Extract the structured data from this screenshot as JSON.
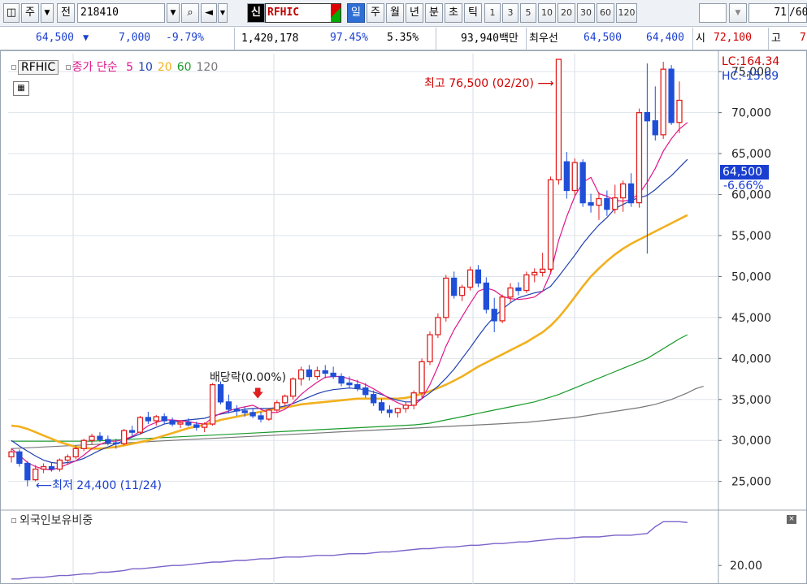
{
  "toolbar": {
    "type_label": "주",
    "prev_label": "전",
    "code": "218410",
    "new_badge": "신",
    "stock_name": "RFHIC",
    "periods": [
      "일",
      "주",
      "월",
      "년",
      "분",
      "초",
      "틱"
    ],
    "active_period": "일",
    "intervals": [
      "1",
      "3",
      "5",
      "10",
      "20",
      "30",
      "60",
      "120"
    ],
    "page": "71",
    "page_total": "/60"
  },
  "quote": {
    "price": "64,500",
    "change_arrow": "▼",
    "change": "7,000",
    "change_pct": "-9.79%",
    "volume": "1,420,178",
    "vol_ratio": "97.45%",
    "turnover": "5.35%",
    "amount": "93,940백만",
    "bid_label": "최우선",
    "ask": "64,500",
    "bid": "64,400",
    "open_label": "시",
    "open": "72,100",
    "high_label": "고",
    "high_trunc": "7"
  },
  "legend": {
    "name": "RFHIC",
    "ma_label": "종가 단순",
    "ma_periods": [
      "5",
      "10",
      "20",
      "60",
      "120"
    ],
    "ma_colors": [
      "#e0168c",
      "#1f3fb0",
      "#f2b01e",
      "#1a9a2a",
      "#777777"
    ],
    "lc": "LC:164.34",
    "hc": "HC:-15.69",
    "sub_label": "외국인보유비중"
  },
  "annotations": {
    "high": "최고 76,500 (02/20)",
    "low": "최저 24,400 (11/24)",
    "dividend": "배당락(0.00%)"
  },
  "price_box": {
    "value": "64,500",
    "pct": "-6.66%"
  },
  "colors": {
    "up": "#e0201e",
    "down": "#1f4fd8",
    "accent": "#2e6fd6"
  },
  "chart_data": {
    "type": "candlestick",
    "title": "RFHIC",
    "y_ticks": [
      25000,
      30000,
      35000,
      40000,
      45000,
      50000,
      55000,
      60000,
      65000,
      70000,
      75000
    ],
    "y_tick_labels": [
      "25,000",
      "30,000",
      "35,000",
      "40,000",
      "45,000",
      "50,000",
      "55,000",
      "60,000",
      "65,000",
      "70,000",
      "75,000"
    ],
    "ylim": [
      21500,
      77200
    ],
    "grid": true,
    "candles": [
      [
        28000,
        29000,
        27300,
        28600
      ],
      [
        28600,
        28900,
        26800,
        27200
      ],
      [
        27200,
        27500,
        24400,
        25200
      ],
      [
        25200,
        27000,
        25000,
        26500
      ],
      [
        26500,
        27200,
        26000,
        26800
      ],
      [
        26800,
        27300,
        26200,
        26500
      ],
      [
        26500,
        27800,
        26200,
        27600
      ],
      [
        27600,
        28300,
        27000,
        28000
      ],
      [
        28000,
        29300,
        27700,
        29000
      ],
      [
        29000,
        30200,
        28700,
        30000
      ],
      [
        30000,
        30800,
        29500,
        30500
      ],
      [
        30500,
        31000,
        29800,
        30100
      ],
      [
        30100,
        30600,
        29400,
        29700
      ],
      [
        29700,
        30200,
        29000,
        29600
      ],
      [
        29600,
        31400,
        29400,
        31200
      ],
      [
        31200,
        31800,
        30500,
        31000
      ],
      [
        31000,
        33000,
        30700,
        32800
      ],
      [
        32800,
        33500,
        32000,
        32400
      ],
      [
        32400,
        33100,
        31800,
        32900
      ],
      [
        32900,
        33300,
        32000,
        32400
      ],
      [
        32400,
        32800,
        31700,
        32000
      ],
      [
        32000,
        32500,
        31500,
        32200
      ],
      [
        32200,
        32700,
        31700,
        31900
      ],
      [
        31900,
        32300,
        31200,
        31600
      ],
      [
        31600,
        32200,
        31000,
        32000
      ],
      [
        32000,
        37000,
        31800,
        36800
      ],
      [
        36800,
        37200,
        34400,
        34700
      ],
      [
        34700,
        35600,
        33300,
        33800
      ],
      [
        33800,
        34300,
        33000,
        33600
      ],
      [
        33600,
        34100,
        32900,
        33400
      ],
      [
        33400,
        33900,
        32700,
        33000
      ],
      [
        33000,
        33500,
        32200,
        32600
      ],
      [
        32600,
        33900,
        32400,
        33700
      ],
      [
        33700,
        34900,
        33400,
        34600
      ],
      [
        34600,
        35600,
        34200,
        35400
      ],
      [
        35400,
        37700,
        35000,
        37500
      ],
      [
        37500,
        39000,
        36700,
        38600
      ],
      [
        38600,
        39200,
        37300,
        37800
      ],
      [
        37800,
        39000,
        37400,
        38500
      ],
      [
        38500,
        39200,
        37600,
        38200
      ],
      [
        38200,
        39000,
        37500,
        37800
      ],
      [
        37800,
        38200,
        36600,
        37000
      ],
      [
        37000,
        37800,
        36300,
        36800
      ],
      [
        36800,
        37400,
        36000,
        36400
      ],
      [
        36400,
        37000,
        35200,
        35600
      ],
      [
        35600,
        36100,
        34200,
        34600
      ],
      [
        34600,
        35100,
        33300,
        33700
      ],
      [
        33700,
        34300,
        32800,
        33400
      ],
      [
        33400,
        34000,
        32800,
        33900
      ],
      [
        33900,
        34700,
        33400,
        34300
      ],
      [
        34300,
        36100,
        33800,
        35800
      ],
      [
        35800,
        40000,
        35200,
        39600
      ],
      [
        39600,
        43300,
        39200,
        42900
      ],
      [
        42900,
        45500,
        42500,
        45000
      ],
      [
        45000,
        50200,
        44500,
        49800
      ],
      [
        49800,
        50600,
        47300,
        47700
      ],
      [
        47700,
        49000,
        47000,
        48700
      ],
      [
        48700,
        51200,
        48300,
        50800
      ],
      [
        50800,
        51400,
        48700,
        49200
      ],
      [
        49200,
        49900,
        45500,
        46000
      ],
      [
        46000,
        47400,
        43200,
        44600
      ],
      [
        44600,
        47800,
        44300,
        47500
      ],
      [
        47500,
        49200,
        46900,
        48600
      ],
      [
        48600,
        49300,
        47700,
        48300
      ],
      [
        48300,
        50600,
        48000,
        50200
      ],
      [
        50200,
        51000,
        49300,
        50500
      ],
      [
        50500,
        52900,
        50000,
        50900
      ],
      [
        50900,
        62200,
        50500,
        61800
      ],
      [
        61800,
        76500,
        61200,
        76500
      ],
      [
        64000,
        65200,
        59500,
        60500
      ],
      [
        60500,
        64400,
        59900,
        63900
      ],
      [
        63900,
        64300,
        58500,
        59000
      ],
      [
        59000,
        60100,
        57800,
        58700
      ],
      [
        58700,
        60300,
        56900,
        59500
      ],
      [
        59500,
        60500,
        57400,
        58200
      ],
      [
        58200,
        61200,
        57700,
        59600
      ],
      [
        59600,
        61700,
        57900,
        61300
      ],
      [
        61300,
        62600,
        58500,
        59000
      ],
      [
        59000,
        70500,
        58400,
        70000
      ],
      [
        70000,
        76000,
        52800,
        69000
      ],
      [
        69000,
        73200,
        66600,
        67300
      ],
      [
        67300,
        76200,
        66800,
        75300
      ],
      [
        75300,
        75800,
        68500,
        68800
      ],
      [
        68800,
        73800,
        67500,
        71500
      ]
    ],
    "ma5": [
      29000,
      28200,
      27300,
      26800,
      26500,
      26400,
      26700,
      27100,
      27500,
      28200,
      29000,
      29500,
      29900,
      29900,
      30100,
      30500,
      31100,
      31800,
      32200,
      32500,
      32500,
      32400,
      32300,
      32100,
      32000,
      32800,
      33300,
      33600,
      33900,
      34100,
      34300,
      33800,
      33400,
      33400,
      33800,
      34600,
      35600,
      36400,
      37100,
      37700,
      37800,
      37800,
      37500,
      37200,
      36800,
      36300,
      35700,
      35100,
      34600,
      34200,
      34300,
      35100,
      36800,
      39000,
      41500,
      43500,
      45100,
      46700,
      48200,
      48600,
      48300,
      47600,
      47300,
      47200,
      47300,
      47500,
      48200,
      50400,
      54400,
      57300,
      59800,
      61500,
      62100,
      60100,
      59800,
      59300,
      59200,
      59400,
      60100,
      61500,
      63200,
      65300,
      66800,
      68000,
      68800
    ],
    "ma10": [
      30000,
      29300,
      28700,
      28100,
      27600,
      27300,
      27200,
      27300,
      27500,
      27800,
      28300,
      28800,
      29200,
      29600,
      30000,
      30400,
      30800,
      31200,
      31600,
      32000,
      32200,
      32400,
      32500,
      32600,
      32700,
      33000,
      33200,
      33400,
      33600,
      33800,
      33900,
      33900,
      33900,
      34000,
      34200,
      34500,
      34900,
      35300,
      35700,
      36000,
      36200,
      36300,
      36400,
      36300,
      36200,
      35900,
      35600,
      35200,
      34900,
      34700,
      34700,
      35100,
      35800,
      36600,
      37600,
      38700,
      40000,
      41300,
      42700,
      44000,
      45100,
      46000,
      46800,
      47400,
      47700,
      48000,
      48200,
      48800,
      50000,
      51300,
      52600,
      54000,
      55200,
      56300,
      57200,
      58300,
      58800,
      59300,
      59600,
      59900,
      60600,
      61500,
      62300,
      63300,
      64300
    ],
    "ma20": [
      31800,
      31700,
      31400,
      31000,
      30600,
      30200,
      29800,
      29500,
      29200,
      29100,
      29000,
      29000,
      29100,
      29200,
      29400,
      29600,
      29800,
      30000,
      30300,
      30600,
      30900,
      31200,
      31500,
      31700,
      31900,
      32200,
      32500,
      32700,
      32900,
      33100,
      33300,
      33500,
      33700,
      33900,
      34000,
      34200,
      34400,
      34500,
      34600,
      34700,
      34800,
      34900,
      35000,
      35100,
      35100,
      35100,
      35100,
      35100,
      35100,
      35200,
      35400,
      35700,
      36000,
      36400,
      36800,
      37300,
      37800,
      38400,
      39000,
      39500,
      40000,
      40500,
      41000,
      41500,
      42000,
      42600,
      43200,
      44000,
      45000,
      46200,
      47500,
      48800,
      50000,
      51000,
      51900,
      52700,
      53400,
      54000,
      54500,
      55000,
      55500,
      56000,
      56500,
      57000,
      57500
    ],
    "ma60": [
      29900,
      29900,
      29900,
      29900,
      29900,
      29900,
      29900,
      29900,
      29900,
      29900,
      29900,
      29950,
      30000,
      30050,
      30100,
      30150,
      30200,
      30250,
      30300,
      30350,
      30400,
      30450,
      30500,
      30550,
      30600,
      30650,
      30700,
      30750,
      30800,
      30850,
      30900,
      30950,
      31000,
      31050,
      31100,
      31150,
      31200,
      31250,
      31300,
      31350,
      31400,
      31450,
      31500,
      31550,
      31600,
      31650,
      31700,
      31750,
      31800,
      31850,
      31900,
      32000,
      32100,
      32300,
      32500,
      32700,
      32900,
      33100,
      33300,
      33500,
      33700,
      33900,
      34100,
      34300,
      34500,
      34700,
      35000,
      35300,
      35600,
      36000,
      36400,
      36800,
      37200,
      37600,
      38000,
      38400,
      38800,
      39200,
      39600,
      40000,
      40600,
      41200,
      41800,
      42400,
      42900
    ],
    "ma120": [
      29000,
      29050,
      29100,
      29150,
      29200,
      29250,
      29300,
      29350,
      29400,
      29450,
      29500,
      29550,
      29600,
      29650,
      29700,
      29750,
      29800,
      29850,
      29900,
      29950,
      30000,
      30050,
      30100,
      30150,
      30200,
      30250,
      30300,
      30350,
      30400,
      30450,
      30500,
      30550,
      30600,
      30650,
      30700,
      30750,
      30800,
      30850,
      30900,
      30950,
      31000,
      31050,
      31100,
      31150,
      31200,
      31250,
      31300,
      31350,
      31400,
      31450,
      31500,
      31550,
      31600,
      31650,
      31700,
      31750,
      31800,
      31850,
      31900,
      31950,
      32000,
      32050,
      32100,
      32150,
      32200,
      32300,
      32400,
      32500,
      32600,
      32700,
      32800,
      32950,
      33100,
      33250,
      33400,
      33550,
      33700,
      33850,
      34000,
      34200,
      34400,
      34700,
      35000,
      35400,
      35800,
      36300,
      36600
    ],
    "foreign_ratio": {
      "y_ticks": [
        20.0
      ],
      "y_tick_labels": [
        "20.00"
      ],
      "values": [
        19.2,
        19.2,
        19.25,
        19.3,
        19.3,
        19.35,
        19.4,
        19.4,
        19.45,
        19.5,
        19.5,
        19.6,
        19.6,
        19.65,
        19.7,
        19.8,
        19.8,
        19.85,
        19.9,
        19.95,
        20.0,
        20.0,
        20.05,
        20.1,
        20.15,
        20.2,
        20.2,
        20.25,
        20.3,
        20.3,
        20.35,
        20.4,
        20.4,
        20.45,
        20.5,
        20.5,
        20.5,
        20.55,
        20.6,
        20.6,
        20.6,
        20.65,
        20.7,
        20.7,
        20.7,
        20.75,
        20.8,
        20.8,
        20.85,
        20.9,
        20.95,
        21.0,
        21.0,
        21.05,
        21.1,
        21.1,
        21.15,
        21.2,
        21.2,
        21.25,
        21.3,
        21.3,
        21.35,
        21.4,
        21.4,
        21.45,
        21.5,
        21.55,
        21.6,
        21.6,
        21.65,
        21.7,
        21.7,
        21.7,
        21.75,
        21.8,
        21.8,
        21.8,
        21.85,
        21.9,
        22.3,
        22.6,
        22.6,
        22.6,
        22.55
      ],
      "ylim": [
        18.9,
        23.0
      ]
    }
  }
}
